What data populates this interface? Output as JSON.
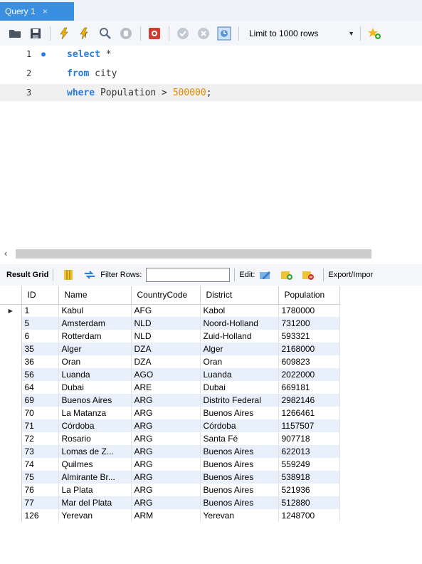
{
  "tab": {
    "title": "Query 1",
    "close": "×"
  },
  "toolbar": {
    "icons": [
      "open-folder-icon",
      "save-icon",
      "execute-icon",
      "execute-current-icon",
      "explain-icon",
      "stop-icon",
      "toggle-error-icon",
      "commit-icon",
      "rollback-icon",
      "autocommit-icon",
      "favorite-add-icon"
    ],
    "limit_label": "Limit to 1000 rows"
  },
  "editor": {
    "lines": [
      {
        "num": "1",
        "keyword": "select",
        "rest": " *"
      },
      {
        "num": "2",
        "keyword": "from",
        "rest": " city"
      },
      {
        "num": "3",
        "keyword": "where",
        "rest": " Population > ",
        "number": "500000",
        "tail": ";"
      }
    ]
  },
  "result_toolbar": {
    "result_grid": "Result Grid",
    "filter_rows": "Filter Rows:",
    "edit": "Edit:",
    "export": "Export/Impor"
  },
  "grid": {
    "columns": [
      "ID",
      "Name",
      "CountryCode",
      "District",
      "Population"
    ],
    "rows": [
      [
        "1",
        "Kabul",
        "AFG",
        "Kabol",
        "1780000"
      ],
      [
        "5",
        "Amsterdam",
        "NLD",
        "Noord-Holland",
        "731200"
      ],
      [
        "6",
        "Rotterdam",
        "NLD",
        "Zuid-Holland",
        "593321"
      ],
      [
        "35",
        "Alger",
        "DZA",
        "Alger",
        "2168000"
      ],
      [
        "36",
        "Oran",
        "DZA",
        "Oran",
        "609823"
      ],
      [
        "56",
        "Luanda",
        "AGO",
        "Luanda",
        "2022000"
      ],
      [
        "64",
        "Dubai",
        "ARE",
        "Dubai",
        "669181"
      ],
      [
        "69",
        "Buenos Aires",
        "ARG",
        "Distrito Federal",
        "2982146"
      ],
      [
        "70",
        "La Matanza",
        "ARG",
        "Buenos Aires",
        "1266461"
      ],
      [
        "71",
        "Córdoba",
        "ARG",
        "Córdoba",
        "1157507"
      ],
      [
        "72",
        "Rosario",
        "ARG",
        "Santa Fé",
        "907718"
      ],
      [
        "73",
        "Lomas de Z...",
        "ARG",
        "Buenos Aires",
        "622013"
      ],
      [
        "74",
        "Quilmes",
        "ARG",
        "Buenos Aires",
        "559249"
      ],
      [
        "75",
        "Almirante Br...",
        "ARG",
        "Buenos Aires",
        "538918"
      ],
      [
        "76",
        "La Plata",
        "ARG",
        "Buenos Aires",
        "521936"
      ],
      [
        "77",
        "Mar del Plata",
        "ARG",
        "Buenos Aires",
        "512880"
      ],
      [
        "126",
        "Yerevan",
        "ARM",
        "Yerevan",
        "1248700"
      ]
    ]
  }
}
